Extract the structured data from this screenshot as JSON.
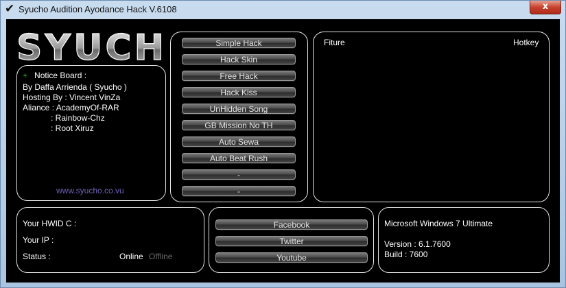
{
  "window": {
    "title": "Syucho Audition Ayodance Hack V.6108",
    "close_label": "x"
  },
  "logo": {
    "text": "SYUCHO"
  },
  "notice": {
    "bullet": "+",
    "heading": "Notice Board :",
    "lines": [
      "By Daffa Arrienda ( Syucho )",
      "Hosting By : Vincent VinZa",
      "Aliance : AcademyOf-RAR",
      ": Rainbow-Chz",
      ": Root Xiruz"
    ],
    "website": "www.syucho.co.vu"
  },
  "hacks": {
    "buttons": [
      "Simple Hack",
      "Hack Skin",
      "Free Hack",
      "Hack Kiss",
      "UnHidden Song",
      "GB Mission No TH",
      "Auto Sewa",
      "Auto Beat Rush",
      "-",
      "-"
    ]
  },
  "features": {
    "fiture_label": "Fiture",
    "hotkey_label": "Hotkey"
  },
  "info": {
    "hwid_label": "Your HWID C :",
    "ip_label": "Your IP :",
    "status_label": "Status :",
    "online": "Online",
    "offline": "Offline"
  },
  "social": {
    "buttons": [
      "Facebook",
      "Twitter",
      "Youtube"
    ]
  },
  "system": {
    "os": "Microsoft Windows 7 Ultimate",
    "version": "Version : 6.1.7600",
    "build": "Build : 7600"
  },
  "colors": {
    "online": "#ffffff",
    "offline": "#6b6b6b",
    "website": "#6f5fb8",
    "accent": "#2fbf2f"
  }
}
